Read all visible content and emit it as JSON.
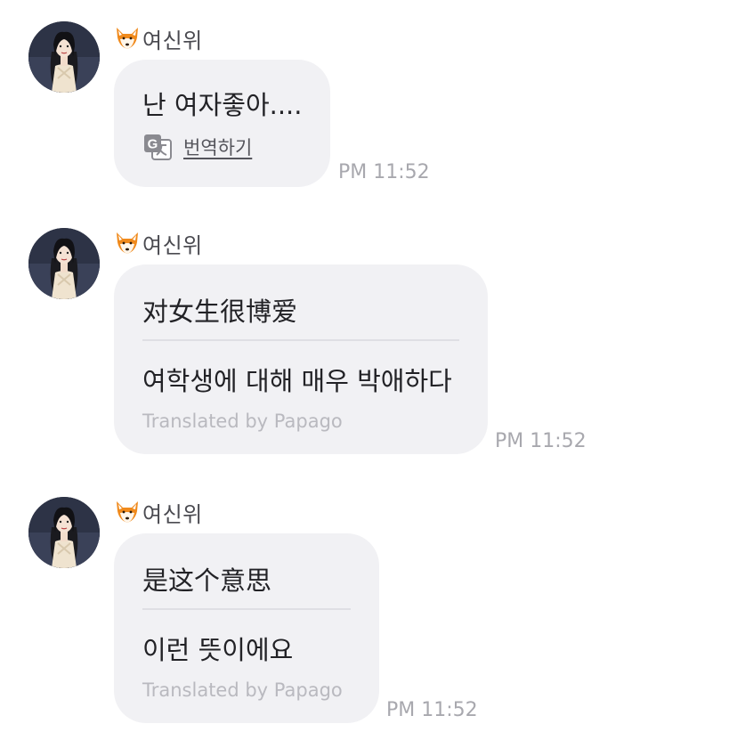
{
  "messages": [
    {
      "sender": "여신위",
      "sender_icon": "fox-face-icon",
      "text": "난 여자좋아....",
      "translate_label": "번역하기",
      "time": "PM 11:52"
    },
    {
      "sender": "여신위",
      "sender_icon": "fox-face-icon",
      "text": "对女生很博爱",
      "translation": "여학생에 대해 매우 박애하다",
      "credit": "Translated by Papago",
      "time": "PM 11:52"
    },
    {
      "sender": "여신위",
      "sender_icon": "fox-face-icon",
      "text": "是这个意思",
      "translation": "이런 뜻이에요",
      "credit": "Translated by Papago",
      "time": "PM 11:52"
    }
  ],
  "colors": {
    "bubble": "#f1f1f4",
    "text": "#222226",
    "muted": "#a8a8ae",
    "divider": "#dfdfe4"
  }
}
